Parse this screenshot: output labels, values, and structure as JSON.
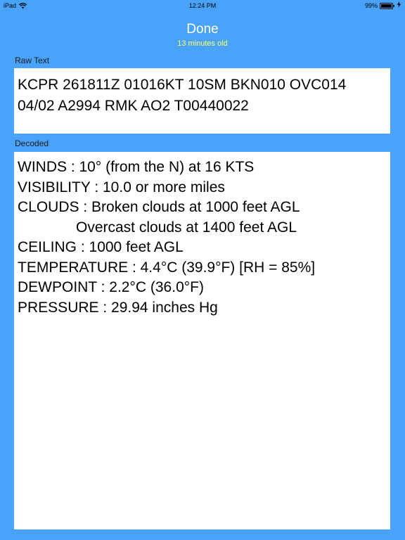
{
  "status_bar": {
    "device": "iPad",
    "time": "12:24 PM",
    "battery": "99%"
  },
  "header": {
    "done_label": "Done",
    "age_text": "13 minutes old"
  },
  "raw": {
    "label": "Raw Text",
    "line1": "KCPR 261811Z 01016KT 10SM BKN010 OVC014",
    "line2": "04/02 A2994 RMK AO2 T00440022"
  },
  "decoded": {
    "label": "Decoded",
    "lines": [
      "WINDS : 10° (from the N) at 16 KTS",
      "VISIBILITY : 10.0 or more miles",
      "CLOUDS : Broken clouds at 1000 feet AGL",
      "Overcast clouds at 1400 feet AGL",
      "CEILING : 1000 feet AGL",
      "TEMPERATURE : 4.4°C (39.9°F) [RH = 85%]",
      "DEWPOINT : 2.2°C (36.0°F)",
      "PRESSURE : 29.94 inches Hg"
    ]
  },
  "colors": {
    "background": "#4aa3fb",
    "age_text": "#ffff66"
  }
}
